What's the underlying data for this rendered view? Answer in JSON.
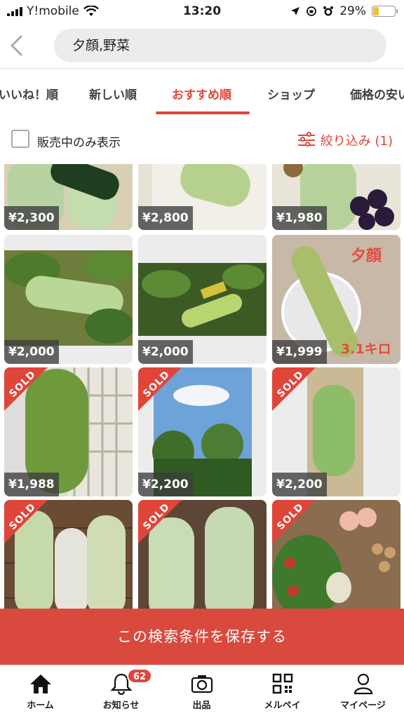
{
  "status_bar": {
    "carrier": "Y!mobile",
    "time": "13:20",
    "battery": "29%",
    "battery_level": 0.29
  },
  "search": {
    "query": "夕顔,野菜",
    "back_icon": "chevron-left-icon"
  },
  "sort_tabs": [
    {
      "label": "いいね！順",
      "active": false
    },
    {
      "label": "新しい順",
      "active": false
    },
    {
      "label": "おすすめ順",
      "active": true
    },
    {
      "label": "ショップ",
      "active": false
    },
    {
      "label": "価格の安い",
      "active": false
    }
  ],
  "filter_row": {
    "checkbox_label": "販売中のみ表示",
    "filter_label": "絞り込み (1)"
  },
  "items": [
    {
      "price": "¥2,300",
      "sold": false
    },
    {
      "price": "¥2,800",
      "sold": false
    },
    {
      "price": "¥1,980",
      "sold": false
    },
    {
      "price": "¥2,000",
      "sold": false
    },
    {
      "price": "¥2,000",
      "sold": false
    },
    {
      "price": "¥1,999",
      "sold": false,
      "overlay_top": "夕顔",
      "overlay_bottom": "3.1キロ"
    },
    {
      "price": "¥1,988",
      "sold": true,
      "sold_label": "SOLD"
    },
    {
      "price": "¥2,200",
      "sold": true,
      "sold_label": "SOLD"
    },
    {
      "price": "¥2,200",
      "sold": true,
      "sold_label": "SOLD"
    },
    {
      "price": "",
      "sold": true,
      "sold_label": "SOLD"
    },
    {
      "price": "",
      "sold": true,
      "sold_label": "SOLD"
    },
    {
      "price": "",
      "sold": true,
      "sold_label": "SOLD"
    }
  ],
  "save_search_button": "この検索条件を保存する",
  "bottom_nav": [
    {
      "label": "ホーム",
      "icon": "home-icon"
    },
    {
      "label": "お知らせ",
      "icon": "bell-icon",
      "badge": "62"
    },
    {
      "label": "出品",
      "icon": "camera-icon"
    },
    {
      "label": "メルペイ",
      "icon": "qr-code-icon"
    },
    {
      "label": "マイページ",
      "icon": "person-icon"
    }
  ],
  "colors": {
    "accent": "#e0453a",
    "save_bar": "#d9493e"
  }
}
